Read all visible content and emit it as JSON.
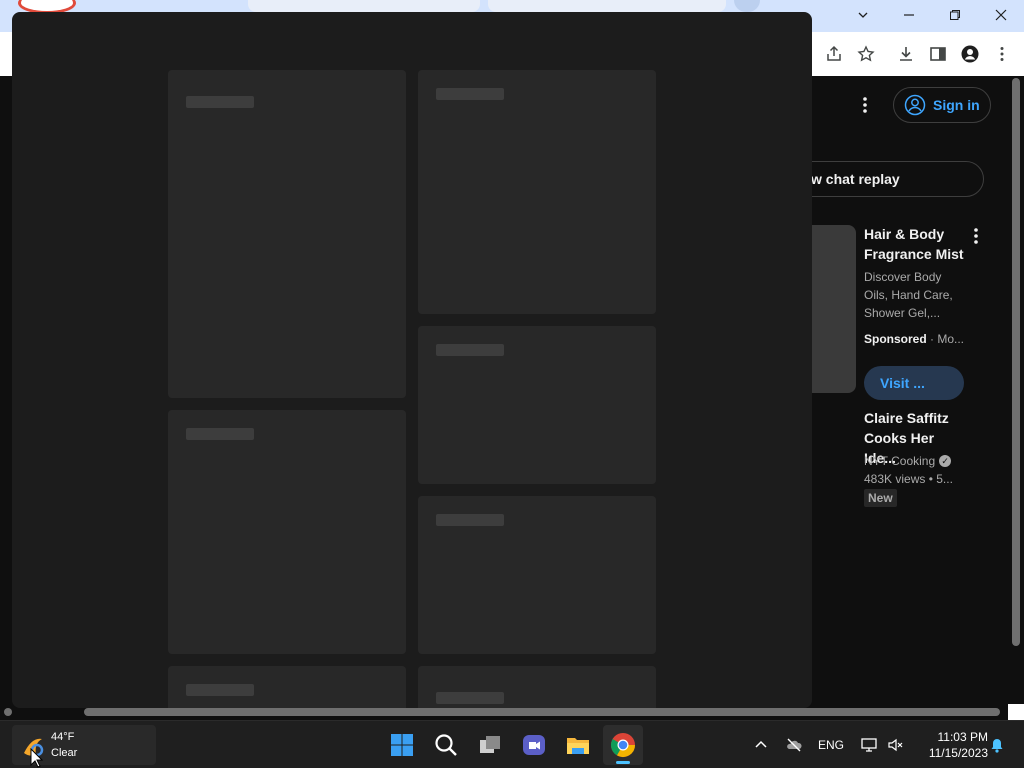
{
  "page": {
    "sign_in_label": "Sign in",
    "chat_replay_label": "w chat replay",
    "ad": {
      "title": "Hair & Body Fragrance Mist",
      "description": "Discover Body Oils, Hand Care, Shower Gel,...",
      "sponsored_label": "Sponsored",
      "sponsor_suffix": "· Mo...",
      "visit_label": "Visit ..."
    },
    "video": {
      "title": "Claire Saffitz Cooks Her Ide...",
      "channel": "NYT Cooking",
      "views": "483K views  • 5...",
      "badge": "New"
    }
  },
  "taskbar": {
    "weather": {
      "temp": "44°F",
      "condition": "Clear"
    },
    "language": "ENG",
    "time": "11:03 PM",
    "date": "11/15/2023"
  },
  "colors": {
    "accent_blue": "#3ea6ff",
    "taskbar_indicator": "#4cc2ff",
    "chrome_frame": "#d3e3fd"
  }
}
